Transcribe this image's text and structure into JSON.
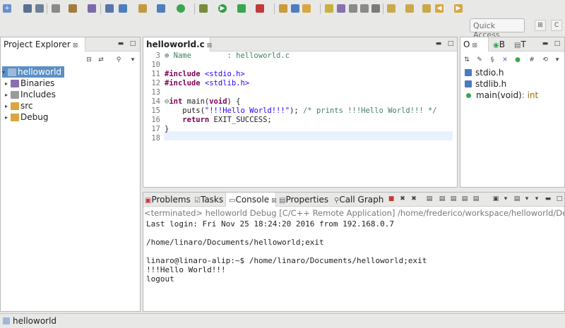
{
  "toolbar": {
    "quick_access_label": "Quick Access",
    "icons": [
      "new-icon",
      "save-icon",
      "save-all-icon",
      "build-icon",
      "debug-icon",
      "run-icon",
      "search-icon",
      "back-icon",
      "forward-icon"
    ]
  },
  "project_explorer": {
    "tab_label": "Project Explorer",
    "close_symbol": "⊠",
    "tree": [
      {
        "label": "helloworld",
        "selected": true,
        "icon": "project-icon"
      },
      {
        "label": "Binaries",
        "icon": "binaries-icon"
      },
      {
        "label": "Includes",
        "icon": "includes-icon"
      },
      {
        "label": "src",
        "icon": "folder-icon"
      },
      {
        "label": "Debug",
        "icon": "folder-icon"
      }
    ]
  },
  "editor": {
    "tab_label": "helloworld.c",
    "close_symbol": "⊠",
    "lines": [
      {
        "num": "3",
        "marker": "⊕",
        "text": " Name        : helloworld.c"
      },
      {
        "num": "10",
        "text": ""
      },
      {
        "num": "11",
        "text": "#include <stdio.h>"
      },
      {
        "num": "12",
        "text": "#include <stdlib.h>"
      },
      {
        "num": "13",
        "text": ""
      },
      {
        "num": "14",
        "marker": "⊖",
        "text": "int main(void) {"
      },
      {
        "num": "15",
        "text": "    puts(\"!!!Hello World!!!\"); /* prints !!!Hello World!!! */"
      },
      {
        "num": "16",
        "text": "    return EXIT_SUCCESS;"
      },
      {
        "num": "17",
        "text": "}"
      },
      {
        "num": "18",
        "text": ""
      }
    ]
  },
  "outline": {
    "tabs": [
      "O",
      "B",
      "T"
    ],
    "items": [
      {
        "label": "stdio.h",
        "kind": "include"
      },
      {
        "label": "stdlib.h",
        "kind": "include"
      },
      {
        "label": "main(void)",
        "suffix": " : int",
        "kind": "function"
      }
    ]
  },
  "bottom_panel": {
    "tabs": [
      "Problems",
      "Tasks",
      "Console",
      "Properties",
      "Call Graph"
    ],
    "active_tab": "Console",
    "console_header": "<terminated> helloworld Debug [C/C++ Remote Application] /home/frederico/workspace/helloworld/Debug/he",
    "console_lines": [
      "Last login: Fri Nov 25 18:24:20 2016 from 192.168.0.7",
      "",
      "/home/linaro/Documents/helloworld;exit",
      "",
      "linaro@linaro-alip:~$ /home/linaro/Documents/helloworld;exit",
      "!!!Hello World!!!",
      "logout"
    ]
  },
  "statusbar": {
    "text": "helloworld"
  },
  "colors": {
    "keyword": "#7f0055",
    "string": "#2a00ff",
    "comment": "#3f7f5f",
    "selection": "#5a90c6"
  }
}
